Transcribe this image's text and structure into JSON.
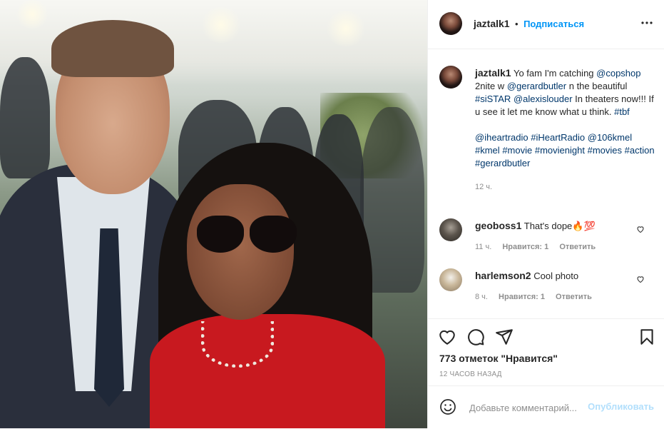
{
  "header": {
    "username": "jaztalk1",
    "separator": "•",
    "follow_label": "Подписаться",
    "more_icon": "more-horizontal-icon"
  },
  "caption": {
    "username": "jaztalk1",
    "text_1": " Yo fam I'm catching ",
    "tag_copshop": "@copshop",
    "text_2": " 2nite w ",
    "tag_gerardbutler": "@gerardbutler",
    "text_3": " n the beautiful ",
    "tag_sistar": "#siSTAR",
    "text_4": " ",
    "tag_alexislouder": "@alexislouder",
    "text_5": " In theaters now!!! If u see it let me know what u think. ",
    "tag_tbf": "#tbf",
    "tags_line": [
      "@iheartradio",
      "#iHeartRadio",
      "@106kmel",
      "#kmel",
      "#movie",
      "#movienight",
      "#movies",
      "#action",
      "#gerardbutler"
    ],
    "time": "12 ч."
  },
  "comments": [
    {
      "username": "geoboss1",
      "text": "That's dope🔥💯",
      "time": "11 ч.",
      "likes": "Нравится: 1",
      "reply": "Ответить"
    },
    {
      "username": "harlemson2",
      "text": "Cool photo",
      "time": "8 ч.",
      "likes": "Нравится: 1",
      "reply": "Ответить"
    }
  ],
  "actions": {
    "likes": "773 отметок \"Нравится\"",
    "posted": "12 часов назад",
    "icons": [
      "heart-icon",
      "comment-icon",
      "share-icon",
      "bookmark-icon"
    ]
  },
  "add_comment": {
    "placeholder": "Добавьте комментарий...",
    "publish_label": "Опубликовать",
    "emoji_icon": "emoji-icon"
  },
  "colors": {
    "accent": "#0095f6",
    "tag": "#00376b",
    "muted": "#8e8e8e",
    "publish_disabled": "#b2dffc"
  }
}
